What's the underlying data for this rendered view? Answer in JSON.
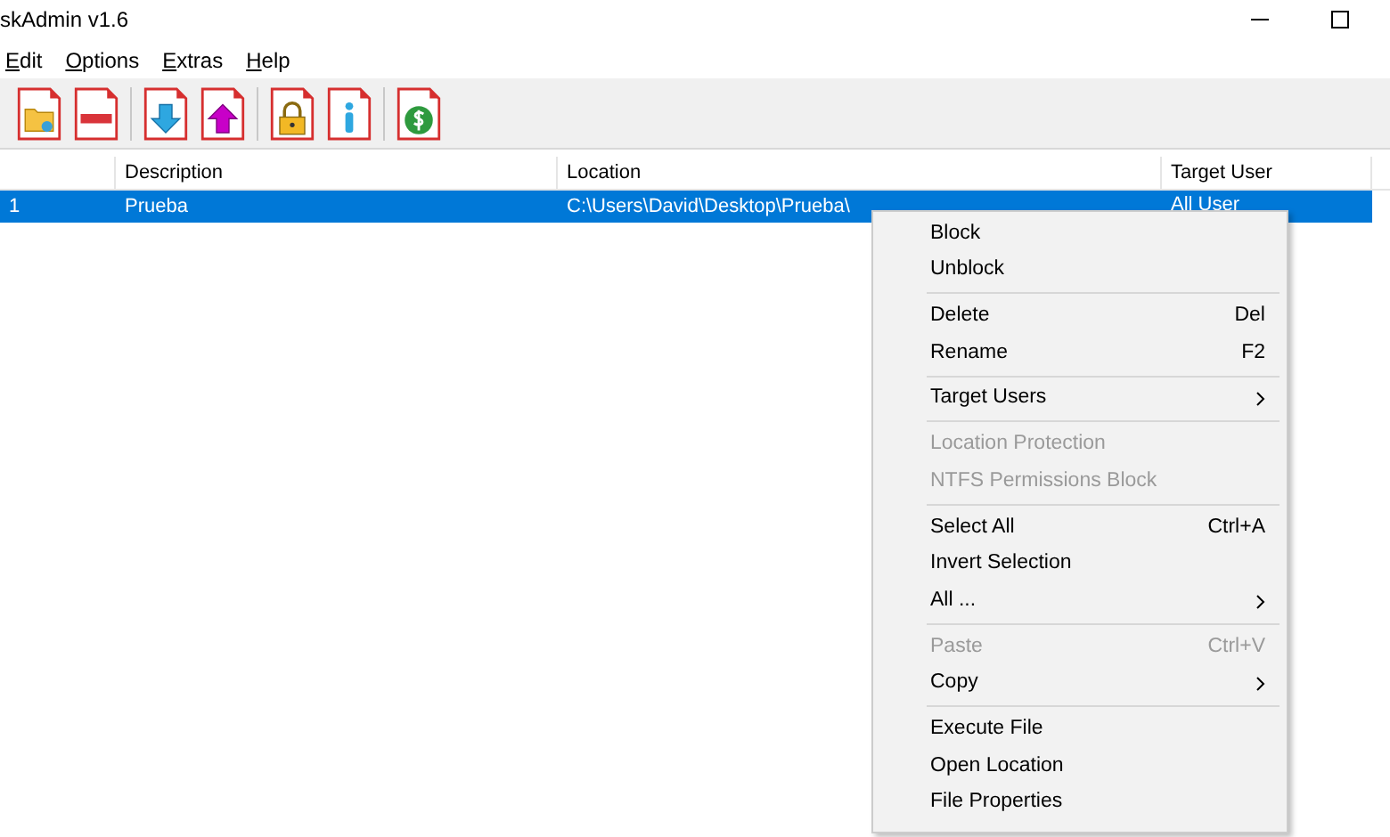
{
  "window": {
    "title": "skAdmin v1.6"
  },
  "menu_bar": [
    "Edit",
    "Options",
    "Extras",
    "Help"
  ],
  "toolbar": [
    [
      {
        "kind": "add"
      },
      {
        "kind": "remove"
      }
    ],
    [
      {
        "kind": "down"
      },
      {
        "kind": "up"
      }
    ],
    [
      {
        "kind": "lock"
      },
      {
        "kind": "info"
      }
    ],
    [
      {
        "kind": "donate"
      }
    ]
  ],
  "table": {
    "columns": [
      "Description",
      "Location",
      "Target User"
    ],
    "rows": [
      {
        "number": "1",
        "description": "Prueba",
        "location": "C:\\Users\\David\\Desktop\\Prueba\\",
        "target_user": "All User",
        "selected": true
      }
    ]
  },
  "context_menu": [
    [
      {
        "label": "Block",
        "disabled": false,
        "submenu": false
      },
      {
        "label": "Unblock",
        "disabled": false,
        "submenu": false
      }
    ],
    [
      {
        "label": "Delete",
        "shortcut": "Del",
        "disabled": false,
        "submenu": false
      },
      {
        "label": "Rename",
        "shortcut": "F2",
        "disabled": false,
        "submenu": false
      }
    ],
    [
      {
        "label": "Target Users",
        "disabled": false,
        "submenu": true
      }
    ],
    [
      {
        "label": "Location Protection",
        "disabled": true,
        "submenu": false
      },
      {
        "label": "NTFS Permissions Block",
        "disabled": true,
        "submenu": false
      }
    ],
    [
      {
        "label": "Select All",
        "shortcut": "Ctrl+A",
        "disabled": false,
        "submenu": false
      },
      {
        "label": "Invert Selection",
        "disabled": false,
        "submenu": false
      },
      {
        "label": "All ...",
        "disabled": false,
        "submenu": true
      }
    ],
    [
      {
        "label": "Paste",
        "shortcut": "Ctrl+V",
        "disabled": true,
        "submenu": false
      },
      {
        "label": "Copy",
        "disabled": false,
        "submenu": true
      }
    ],
    [
      {
        "label": "Execute File",
        "disabled": false,
        "submenu": false
      },
      {
        "label": "Open Location",
        "disabled": false,
        "submenu": false
      },
      {
        "label": "File Properties",
        "disabled": false,
        "submenu": false
      }
    ]
  ]
}
